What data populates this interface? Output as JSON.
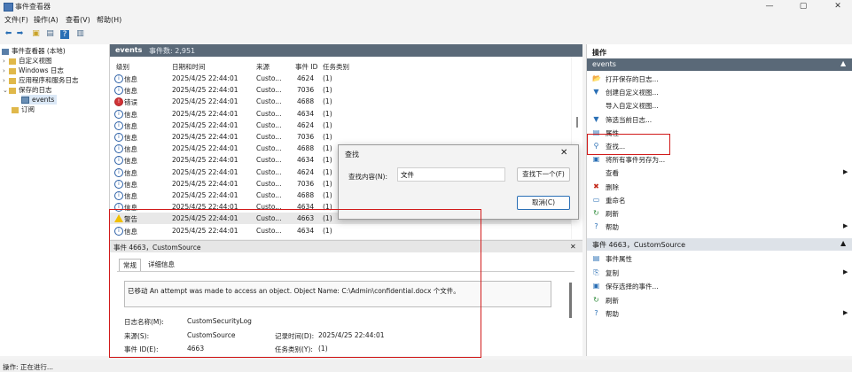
{
  "window": {
    "title": "事件查看器",
    "controls": [
      "—",
      "▢",
      "✕"
    ]
  },
  "menu": [
    "文件(F)",
    "操作(A)",
    "查看(V)",
    "帮助(H)"
  ],
  "toolbar": [
    "back-icon",
    "forward-icon",
    "folder-icon",
    "list-view-icon",
    "help-icon",
    "preview-icon"
  ],
  "tree": [
    {
      "label": "事件查看器 (本地)",
      "chev": "",
      "icon": "computer-icon"
    },
    {
      "label": "自定义视图",
      "chev": "›",
      "icon": "folder-icon"
    },
    {
      "label": "Windows 日志",
      "chev": "›",
      "icon": "folder-icon"
    },
    {
      "label": "应用程序和服务日志",
      "chev": "›",
      "icon": "folder-icon"
    },
    {
      "label": "保存的日志",
      "chev": "⌄",
      "icon": "folder-icon"
    },
    {
      "label": "events",
      "chev": "",
      "icon": "log-icon"
    },
    {
      "label": "订阅",
      "chev": "",
      "icon": "subscription-icon"
    }
  ],
  "center": {
    "title": "events",
    "count": "事件数: 2,951"
  },
  "columns": [
    "级别",
    "日期和时间",
    "来源",
    "事件 ID",
    "任务类别"
  ],
  "events": [
    {
      "level": "信息",
      "kind": "info",
      "date": "2025/4/25 22:44:01",
      "source": "Custo...",
      "id": "4624",
      "task": "(1)"
    },
    {
      "level": "信息",
      "kind": "info",
      "date": "2025/4/25 22:44:01",
      "source": "Custo...",
      "id": "7036",
      "task": "(1)"
    },
    {
      "level": "错误",
      "kind": "error",
      "date": "2025/4/25 22:44:01",
      "source": "Custo...",
      "id": "4688",
      "task": "(1)"
    },
    {
      "level": "信息",
      "kind": "info",
      "date": "2025/4/25 22:44:01",
      "source": "Custo...",
      "id": "4634",
      "task": "(1)"
    },
    {
      "level": "信息",
      "kind": "info",
      "date": "2025/4/25 22:44:01",
      "source": "Custo...",
      "id": "4624",
      "task": "(1)"
    },
    {
      "level": "信息",
      "kind": "info",
      "date": "2025/4/25 22:44:01",
      "source": "Custo...",
      "id": "7036",
      "task": "(1)"
    },
    {
      "level": "信息",
      "kind": "info",
      "date": "2025/4/25 22:44:01",
      "source": "Custo...",
      "id": "4688",
      "task": "(1)"
    },
    {
      "level": "信息",
      "kind": "info",
      "date": "2025/4/25 22:44:01",
      "source": "Custo...",
      "id": "4634",
      "task": "(1)"
    },
    {
      "level": "信息",
      "kind": "info",
      "date": "2025/4/25 22:44:01",
      "source": "Custo...",
      "id": "4624",
      "task": "(1)"
    },
    {
      "level": "信息",
      "kind": "info",
      "date": "2025/4/25 22:44:01",
      "source": "Custo...",
      "id": "7036",
      "task": "(1)"
    },
    {
      "level": "信息",
      "kind": "info",
      "date": "2025/4/25 22:44:01",
      "source": "Custo...",
      "id": "4688",
      "task": "(1)"
    },
    {
      "level": "信息",
      "kind": "info",
      "date": "2025/4/25 22:44:01",
      "source": "Custo...",
      "id": "4634",
      "task": "(1)"
    },
    {
      "level": "警告",
      "kind": "warn",
      "date": "2025/4/25 22:44:01",
      "source": "Custo...",
      "id": "4663",
      "task": "(1)"
    },
    {
      "level": "信息",
      "kind": "info",
      "date": "2025/4/25 22:44:01",
      "source": "Custo...",
      "id": "4634",
      "task": "(1)"
    }
  ],
  "detail": {
    "header": "事件 4663，CustomSource",
    "close": "✕",
    "tabs": [
      "常规",
      "详细信息"
    ],
    "message": "已移动 An attempt was made to access an object. Object Name: C:\\Admin\\confidential.docx 个文件。",
    "log_name_label": "日志名称(M):",
    "log_name": "CustomSecurityLog",
    "source_label": "来源(S):",
    "source": "CustomSource",
    "logged_label": "记录时间(D):",
    "logged": "2025/4/25 22:44:01",
    "event_id_label": "事件 ID(E):",
    "event_id": "4663",
    "task_label": "任务类别(Y):",
    "task": "(1)"
  },
  "actions": {
    "header": "操作",
    "section1": "events",
    "items1": [
      {
        "label": "打开保存的日志...",
        "icon": "open-log-icon",
        "glyph": "📂"
      },
      {
        "label": "创建自定义视图...",
        "icon": "filter-icon",
        "glyph": "▼"
      },
      {
        "label": "导入自定义视图...",
        "icon": "import-icon",
        "glyph": ""
      },
      {
        "label": "筛选当前日志...",
        "icon": "filter-icon",
        "glyph": "▼"
      },
      {
        "label": "属性",
        "icon": "properties-icon",
        "glyph": "▤"
      },
      {
        "label": "查找...",
        "icon": "find-icon",
        "glyph": "⚲"
      },
      {
        "label": "将所有事件另存为...",
        "icon": "save-icon",
        "glyph": "▣"
      },
      {
        "label": "查看",
        "icon": "view-icon",
        "glyph": "",
        "arrow": "▶"
      },
      {
        "label": "删除",
        "icon": "delete-icon",
        "glyph": "✖"
      },
      {
        "label": "重命名",
        "icon": "rename-icon",
        "glyph": "▭"
      },
      {
        "label": "刷新",
        "icon": "refresh-icon",
        "glyph": "↻"
      },
      {
        "label": "帮助",
        "icon": "help-icon",
        "glyph": "?",
        "arrow": "▶"
      }
    ],
    "section2": "事件 4663，CustomSource",
    "items2": [
      {
        "label": "事件属性",
        "icon": "properties-icon",
        "glyph": "▤"
      },
      {
        "label": "复制",
        "icon": "copy-icon",
        "glyph": "⎘",
        "arrow": "▶"
      },
      {
        "label": "保存选择的事件...",
        "icon": "save-icon",
        "glyph": "▣"
      },
      {
        "label": "刷新",
        "icon": "refresh-icon",
        "glyph": "↻"
      },
      {
        "label": "帮助",
        "icon": "help-icon",
        "glyph": "?",
        "arrow": "▶"
      }
    ]
  },
  "find_dialog": {
    "title": "查找",
    "close": "✕",
    "label": "查找内容(N):",
    "value": "文件",
    "find_next": "查找下一个(F)",
    "cancel": "取消(C)"
  },
  "status": "操作: 正在进行...",
  "colors": {
    "header_bg": "#5a6978",
    "accent": "#2a6fb5",
    "annotation": "#d11a1a"
  }
}
